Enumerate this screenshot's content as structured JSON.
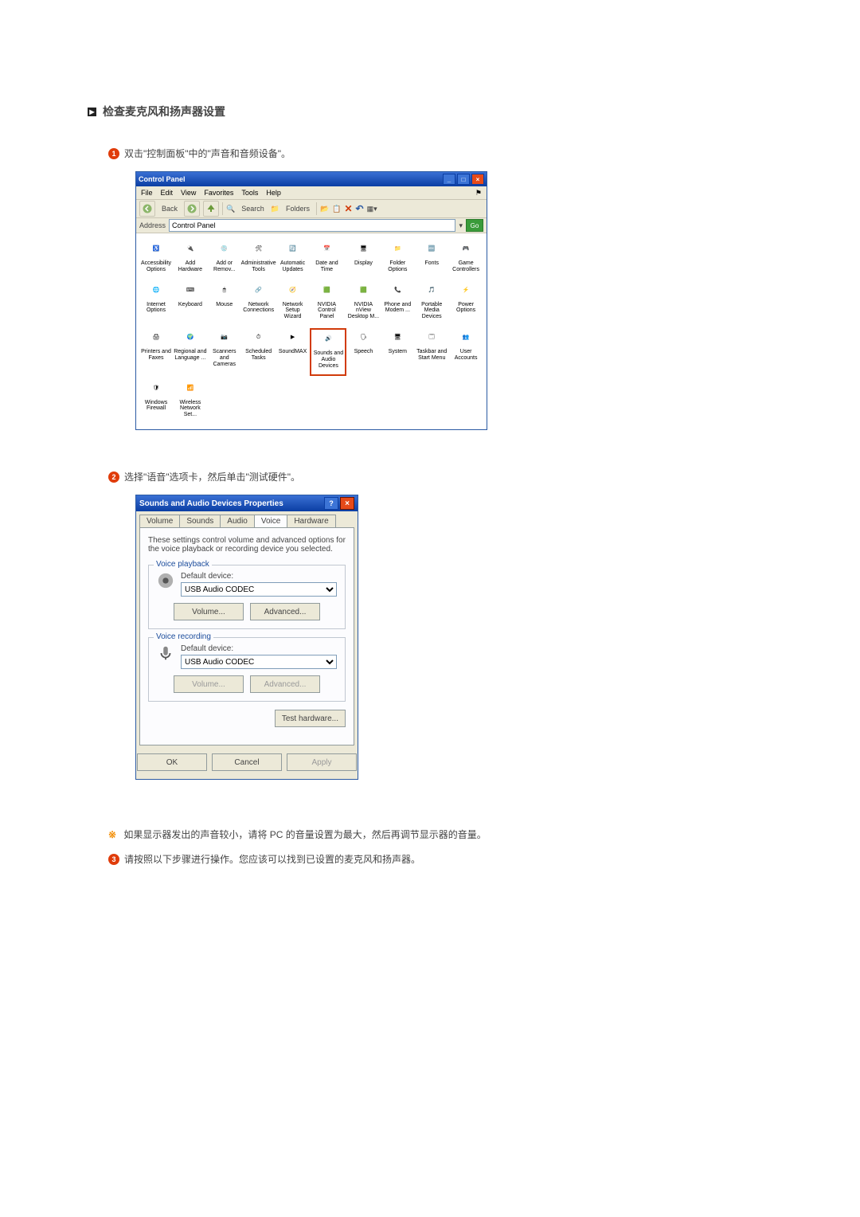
{
  "section_title": "检查麦克风和扬声器设置",
  "step1": "双击\"控制面板\"中的\"声音和音频设备\"。",
  "step2": "选择\"语音\"选项卡，然后单击\"测试硬件\"。",
  "note": "如果显示器发出的声音较小，请将 PC 的音量设置为最大，然后再调节显示器的音量。",
  "step3": "请按照以下步骤进行操作。您应该可以找到已设置的麦克风和扬声器。",
  "cp": {
    "title": "Control Panel",
    "menu": [
      "File",
      "Edit",
      "View",
      "Favorites",
      "Tools",
      "Help"
    ],
    "back": "Back",
    "search": "Search",
    "folders": "Folders",
    "addr_label": "Address",
    "addr_value": "Control Panel",
    "go": "Go",
    "items": [
      {
        "l": "Accessibility Options"
      },
      {
        "l": "Add Hardware"
      },
      {
        "l": "Add or Remov..."
      },
      {
        "l": "Administrative Tools"
      },
      {
        "l": "Automatic Updates"
      },
      {
        "l": "Date and Time"
      },
      {
        "l": "Display"
      },
      {
        "l": "Folder Options"
      },
      {
        "l": "Fonts"
      },
      {
        "l": "Game Controllers"
      },
      {
        "l": "Internet Options"
      },
      {
        "l": "Keyboard"
      },
      {
        "l": "Mouse"
      },
      {
        "l": "Network Connections"
      },
      {
        "l": "Network Setup Wizard"
      },
      {
        "l": "NVIDIA Control Panel"
      },
      {
        "l": "NVIDIA nView Desktop M..."
      },
      {
        "l": "Phone and Modem ..."
      },
      {
        "l": "Portable Media Devices"
      },
      {
        "l": "Power Options"
      },
      {
        "l": "Printers and Faxes"
      },
      {
        "l": "Regional and Language ..."
      },
      {
        "l": "Scanners and Cameras"
      },
      {
        "l": "Scheduled Tasks"
      },
      {
        "l": "SoundMAX"
      },
      {
        "l": "Sounds and Audio Devices",
        "hl": true
      },
      {
        "l": "Speech"
      },
      {
        "l": "System"
      },
      {
        "l": "Taskbar and Start Menu"
      },
      {
        "l": "User Accounts"
      },
      {
        "l": "Windows Firewall"
      },
      {
        "l": "Wireless Network Set..."
      }
    ]
  },
  "sd": {
    "title": "Sounds and Audio Devices Properties",
    "tabs": [
      "Volume",
      "Sounds",
      "Audio",
      "Voice",
      "Hardware"
    ],
    "active_tab": "Voice",
    "desc": "These settings control volume and advanced options for the voice playback or recording device you selected.",
    "grp_play": "Voice playback",
    "grp_rec": "Voice recording",
    "def_label": "Default device:",
    "device": "USB Audio CODEC",
    "btn_vol": "Volume...",
    "btn_adv": "Advanced...",
    "btn_test": "Test hardware...",
    "btn_ok": "OK",
    "btn_cancel": "Cancel",
    "btn_apply": "Apply"
  }
}
